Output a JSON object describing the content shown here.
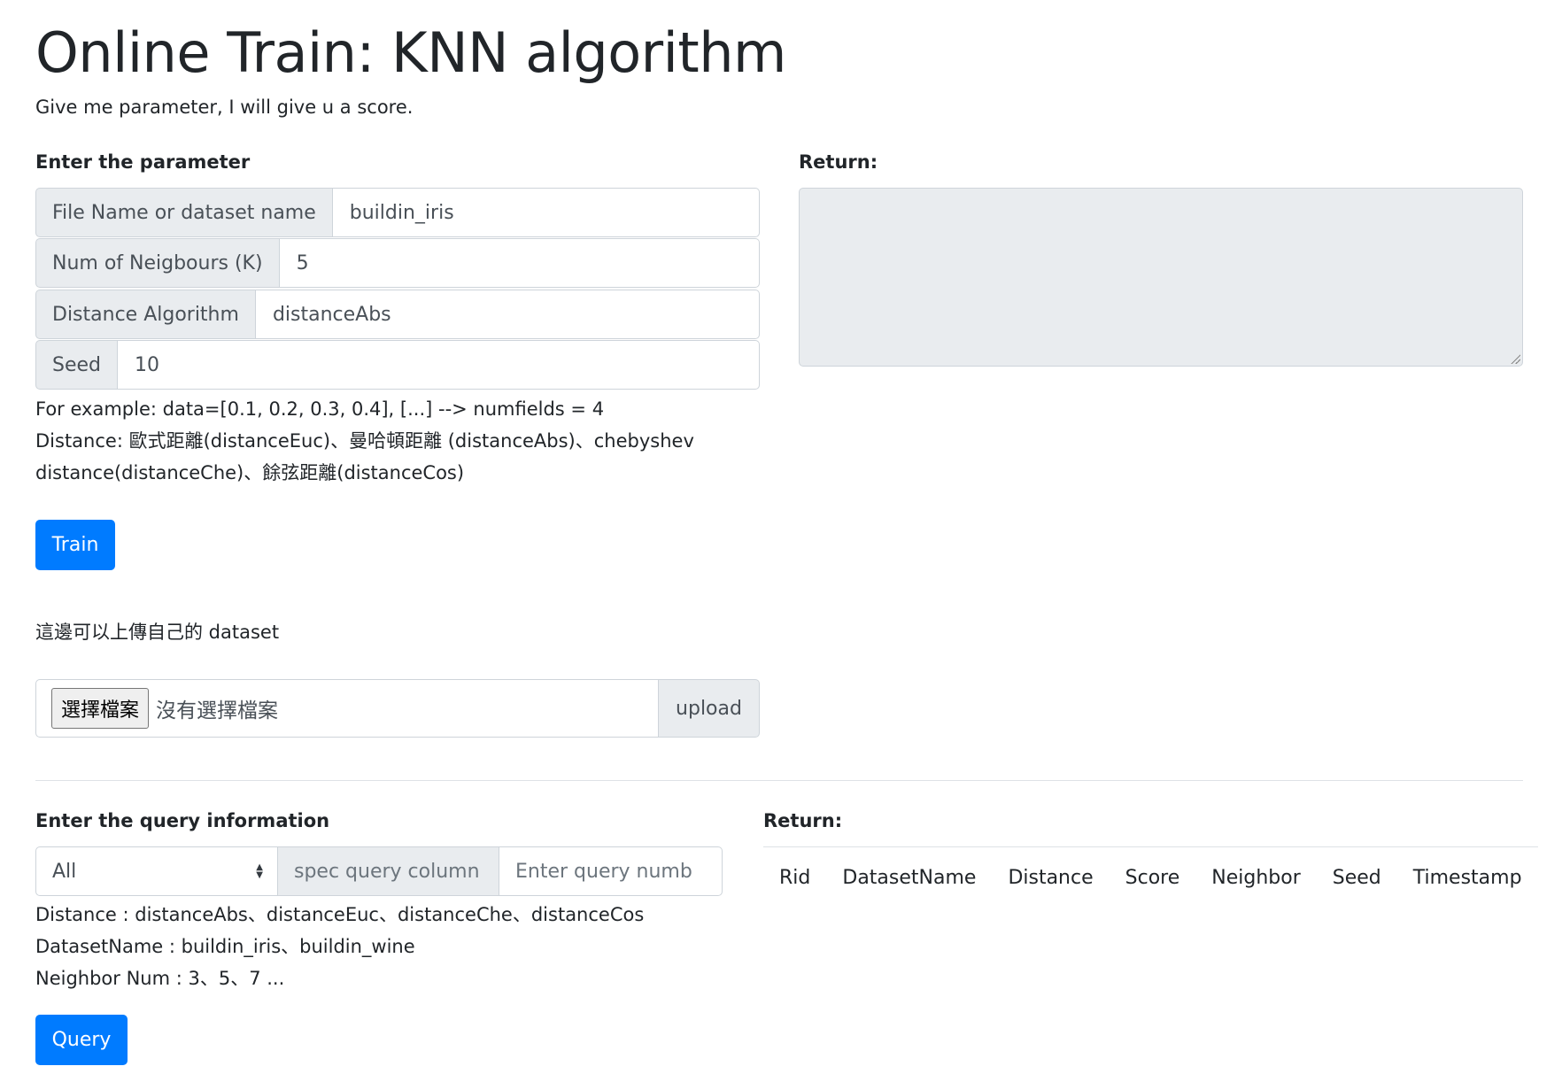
{
  "header": {
    "title": "Online Train: KNN algorithm",
    "subtitle": "Give me parameter, I will give u a score."
  },
  "train_form": {
    "heading": "Enter the parameter",
    "fields": [
      {
        "label": "File Name or dataset name",
        "value": "buildin_iris"
      },
      {
        "label": "Num of Neigbours (K)",
        "value": "5"
      },
      {
        "label": "Distance Algorithm",
        "value": "distanceAbs"
      },
      {
        "label": "Seed",
        "value": "10"
      }
    ],
    "help_lines": [
      "For example: data=[0.1, 0.2, 0.3, 0.4], [...] --> numfields = 4",
      "Distance: 歐式距離(distanceEuc)、曼哈頓距離 (distanceAbs)、chebyshev",
      "distance(distanceChe)、餘弦距離(distanceCos)"
    ],
    "train_button": "Train"
  },
  "train_return": {
    "heading": "Return:",
    "value": ""
  },
  "upload": {
    "label": "這邊可以上傳自己的 dataset",
    "choose_button": "選擇檔案",
    "no_file_text": "沒有選擇檔案",
    "upload_button": "upload"
  },
  "query_form": {
    "heading": "Enter the query information",
    "select_value": "All",
    "column_placeholder": "spec query column",
    "number_placeholder": "Enter query numb",
    "help_lines": [
      "Distance : distanceAbs、distanceEuc、distanceChe、distanceCos",
      "DatasetName : buildin_iris、buildin_wine",
      "Neighbor Num : 3、5、7 ..."
    ],
    "query_button": "Query"
  },
  "query_return": {
    "heading": "Return:",
    "columns": [
      "Rid",
      "DatasetName",
      "Distance",
      "Score",
      "Neighbor",
      "Seed",
      "Timestamp"
    ]
  },
  "colors": {
    "primary": "#007bff",
    "prepend_bg": "#e9ecef",
    "border": "#ced4da"
  }
}
